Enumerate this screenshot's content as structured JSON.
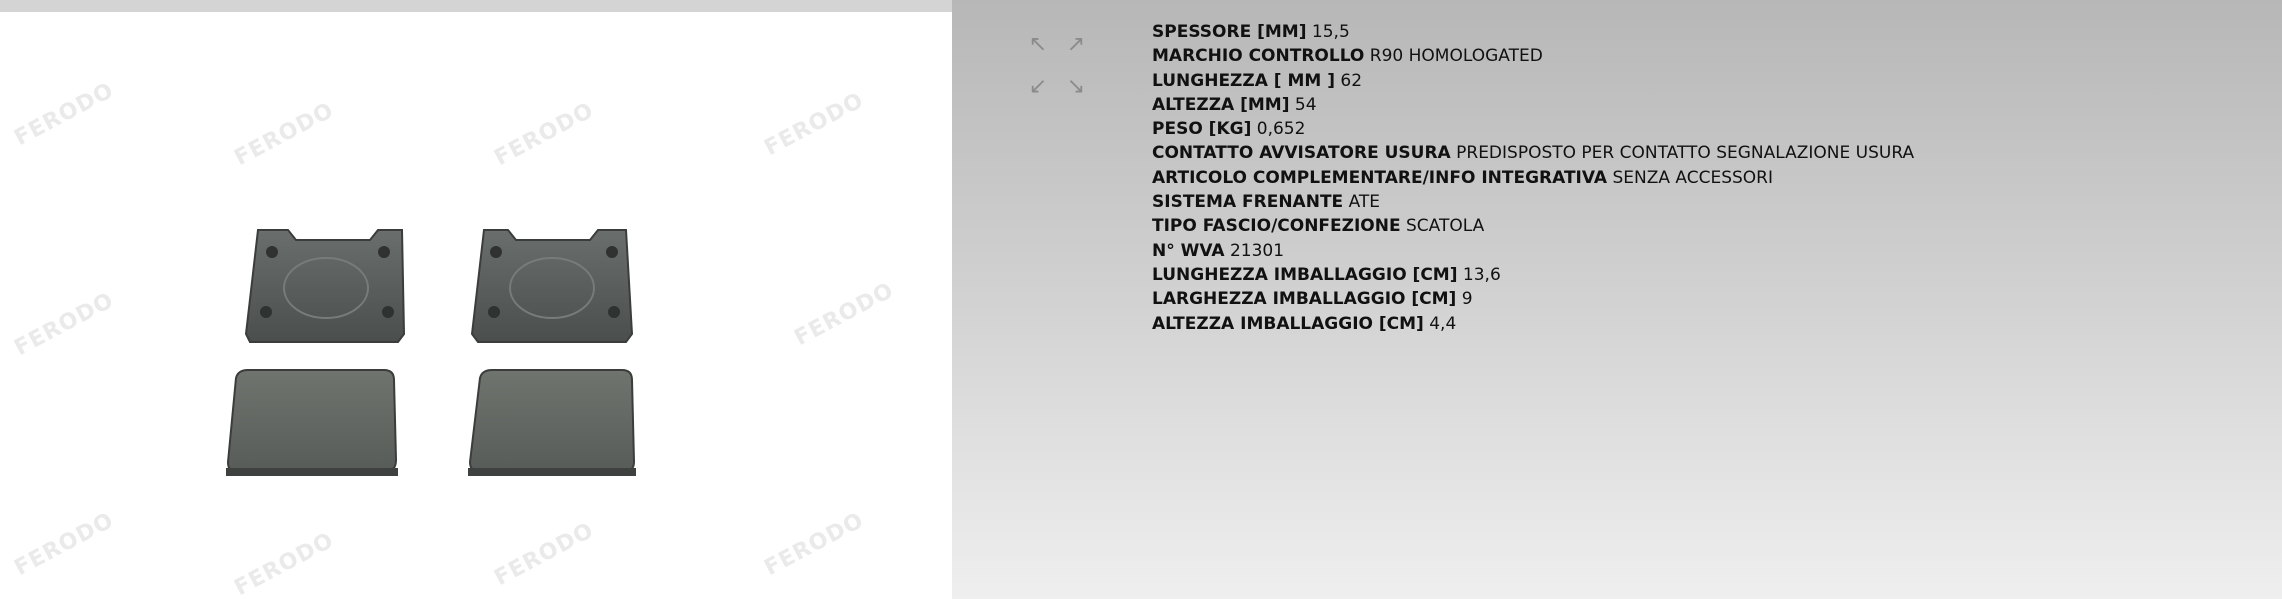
{
  "image": {
    "watermark_text": "FERODO",
    "zoom_icons": [
      "arrow-up-left-icon",
      "arrow-up-right-icon",
      "arrow-down-left-icon",
      "arrow-down-right-icon"
    ]
  },
  "specs": [
    {
      "label": "SPESSORE [MM]",
      "value": "15,5"
    },
    {
      "label": "MARCHIO CONTROLLO",
      "value": "R90 HOMOLOGATED"
    },
    {
      "label": "LUNGHEZZA [ MM ]",
      "value": "62"
    },
    {
      "label": "ALTEZZA [MM]",
      "value": "54"
    },
    {
      "label": "PESO [KG]",
      "value": "0,652"
    },
    {
      "label": "CONTATTO AVVISATORE USURA",
      "value": "PREDISPOSTO PER CONTATTO SEGNALAZIONE USURA"
    },
    {
      "label": "ARTICOLO COMPLEMENTARE/INFO INTEGRATIVA",
      "value": "SENZA ACCESSORI"
    },
    {
      "label": "SISTEMA FRENANTE",
      "value": "ATE"
    },
    {
      "label": "TIPO FASCIO/CONFEZIONE",
      "value": "SCATOLA"
    },
    {
      "label": "N° WVA",
      "value": "21301"
    },
    {
      "label": "LUNGHEZZA IMBALLAGGIO [CM]",
      "value": "13,6"
    },
    {
      "label": "LARGHEZZA IMBALLAGGIO [CM]",
      "value": "9"
    },
    {
      "label": "ALTEZZA IMBALLAGGIO [CM]",
      "value": "4,4"
    }
  ]
}
